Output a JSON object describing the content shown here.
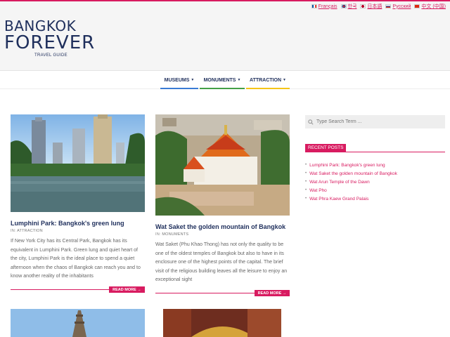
{
  "languages": [
    {
      "label": "Français",
      "flag_colors": [
        "#0055a4",
        "#ffffff",
        "#ef4135"
      ]
    },
    {
      "label": "한국",
      "flag_colors": [
        "#ffffff",
        "#cd2e3a",
        "#0047a0"
      ]
    },
    {
      "label": "日本語",
      "flag_colors": [
        "#ffffff",
        "#bc002d",
        "#ffffff"
      ]
    },
    {
      "label": "Русский",
      "flag_colors": [
        "#ffffff",
        "#0039a6",
        "#d52b1e"
      ]
    },
    {
      "label": "中文 (中国)",
      "flag_colors": [
        "#de2910",
        "#ffde00",
        "#de2910"
      ]
    }
  ],
  "logo": {
    "line1": "BANGKOK",
    "line2": "FOREVER",
    "subtitle": "TRAVEL GUIDE"
  },
  "nav": [
    {
      "label": "MUSEUMS",
      "color": "#3a7bd5"
    },
    {
      "label": "MONUMENTS",
      "color": "#43a047"
    },
    {
      "label": "ATTRACTION",
      "color": "#f5c518"
    }
  ],
  "posts": [
    {
      "title": "Lumphini Park: Bangkok's green lung",
      "meta_prefix": "IN:",
      "category": "ATTRACTION",
      "excerpt": "If New York City has its Central Park, Bangkok has its equivalent in Lumphini Park. Green lung and quiet heart of the city, Lumphini Park is the ideal place to spend a quiet afternoon when the chaos of Bangkok can reach you and to know another reality of the inhabitants",
      "read_more": "READ MORE →"
    },
    {
      "title": "Wat Saket the golden mountain of Bangkok",
      "meta_prefix": "IN:",
      "category": "MONUMENTS",
      "excerpt": "Wat Saket (Phu Khao Thong) has not only the quality to be one of the oldest temples of Bangkok but also to have in its enclosure one of the highest points of the capital. The brief visit of the religious building leaves all the leisure to enjoy an exceptional sight",
      "read_more": "READ MORE →"
    }
  ],
  "search": {
    "placeholder": "Type Search Term ..."
  },
  "sidebar": {
    "recent_title": "RECENT POSTS",
    "recent_posts": [
      "Lumphini Park: Bangkok's green lung",
      "Wat Saket the golden mountain of Bangkok",
      "Wat Arun Temple of the Dawn",
      "Wat Pho",
      "Wat Phra Kaew Grand Palais"
    ]
  },
  "colors": {
    "accent": "#d81b60",
    "brand": "#1f2f5c"
  }
}
